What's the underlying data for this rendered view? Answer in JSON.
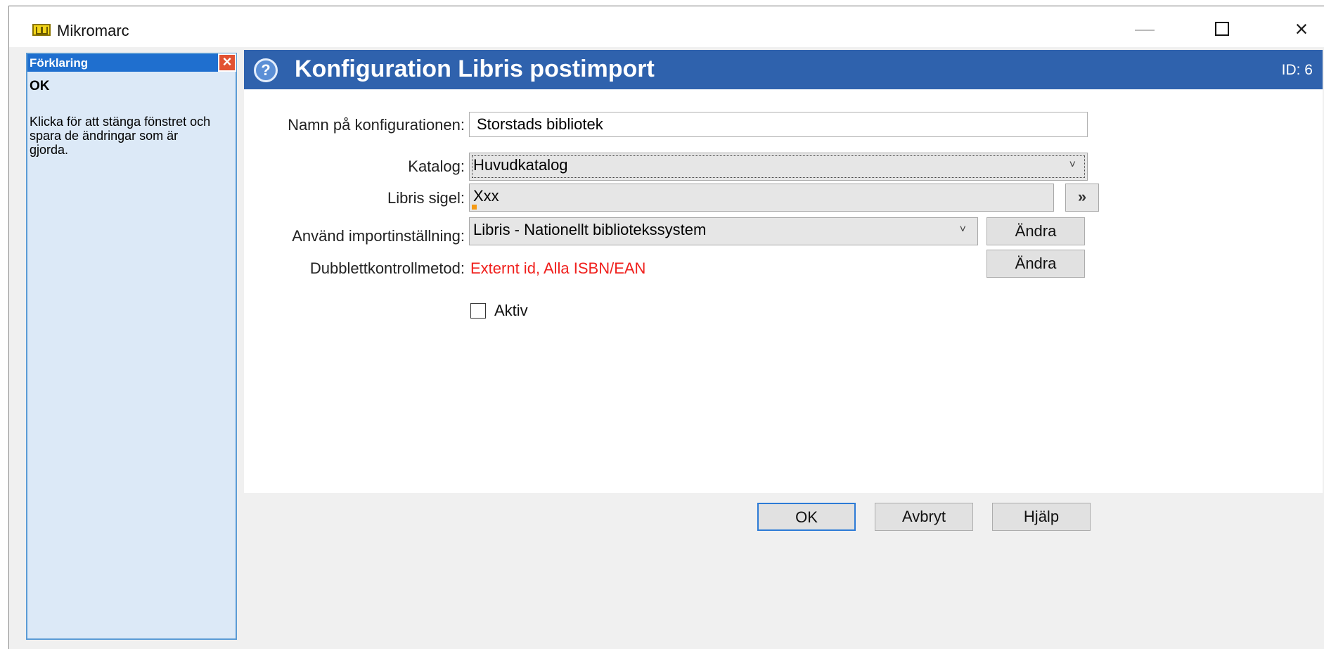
{
  "window": {
    "title": "Mikromarc",
    "controls": {
      "minimize_icon": "minimize-icon",
      "maximize_icon": "maximize-icon",
      "close_icon": "close-icon"
    }
  },
  "explanation_panel": {
    "title": "Förklaring",
    "subject": "OK",
    "description": "Klicka för att stänga fönstret och spara de ändringar som är gjorda.",
    "close_icon": "close-icon"
  },
  "header": {
    "icon": "help-icon",
    "title": "Konfiguration Libris postimport",
    "id_label": "ID: 6"
  },
  "form": {
    "name": {
      "label": "Namn på konfigurationen:",
      "value": "Storstads bibliotek"
    },
    "catalog": {
      "label": "Katalog:",
      "value": "Huvudkatalog"
    },
    "sigel": {
      "label": "Libris sigel:",
      "value": "Xxx"
    },
    "import_setting": {
      "label": "Använd importinställning:",
      "value": "Libris - Nationellt bibliotekssystem",
      "button": "Ändra"
    },
    "duplicate_method": {
      "label": "Dubblettkontrollmetod:",
      "value": "Externt id, Alla ISBN/EAN",
      "button": "Ändra",
      "value_color": "#f0201d"
    },
    "active": {
      "label": "Aktiv",
      "checked": false
    }
  },
  "footer": {
    "ok": "OK",
    "cancel": "Avbryt",
    "help": "Hjälp"
  },
  "colors": {
    "header_bg": "#2f62ad",
    "panel_head_bg": "#1f6fcf",
    "panel_bg": "#dce9f7",
    "accent_red": "#f0201d"
  }
}
